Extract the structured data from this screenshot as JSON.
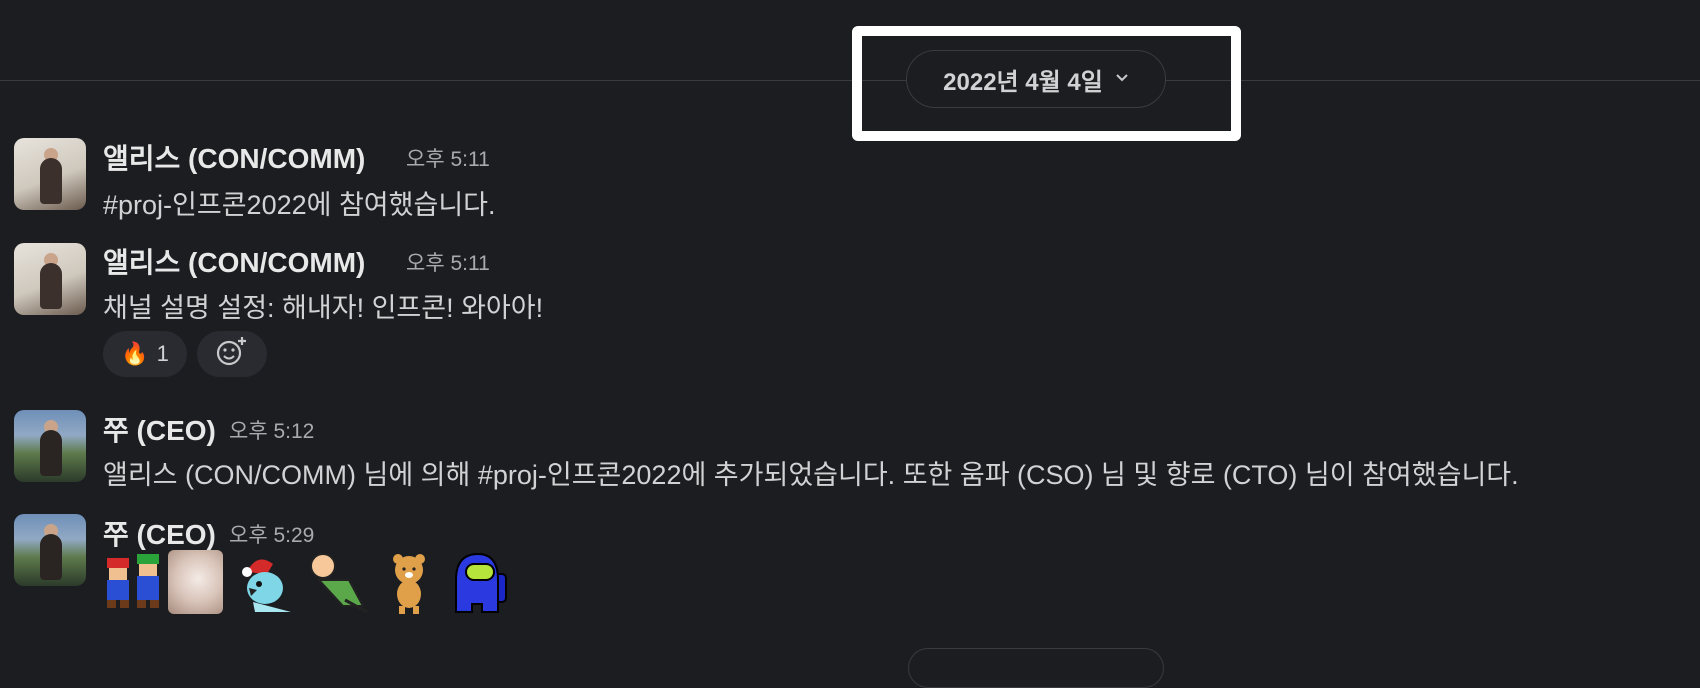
{
  "date_divider": {
    "label": "2022년 4월 4일",
    "chevron_icon": "chevron-down-icon"
  },
  "messages": [
    {
      "author": "앨리스 (CON/COMM)",
      "time": "오후 5:11",
      "text": "#proj-인프콘2022에 참여했습니다."
    },
    {
      "author": "앨리스 (CON/COMM)",
      "time": "오후 5:11",
      "text": "채널 설명 설정: 해내자! 인프콘! 와아아!",
      "reactions": [
        {
          "emoji": "🔥",
          "count": "1"
        }
      ],
      "add_reaction_icon": "add-reaction-icon"
    },
    {
      "author": "쭈 (CEO)",
      "time": "오후 5:12",
      "text": "앨리스 (CON/COMM) 님에 의해 #proj-인프콘2022에 추가되었습니다. 또한 움파 (CSO) 님 및 향로 (CTO) 님이 참여했습니다."
    },
    {
      "author": "쭈 (CEO)",
      "time": "오후 5:29",
      "stickers": [
        "mario-luigi-emoji",
        "blurry-cat-emoji",
        "santa-parrot-emoji",
        "chilling-man-emoji",
        "ryan-bear-emoji",
        "among-us-crewmate-emoji"
      ]
    }
  ],
  "colors": {
    "background": "#1c1d21",
    "text": "#d1d2d3",
    "highlight": "#ffffff"
  }
}
